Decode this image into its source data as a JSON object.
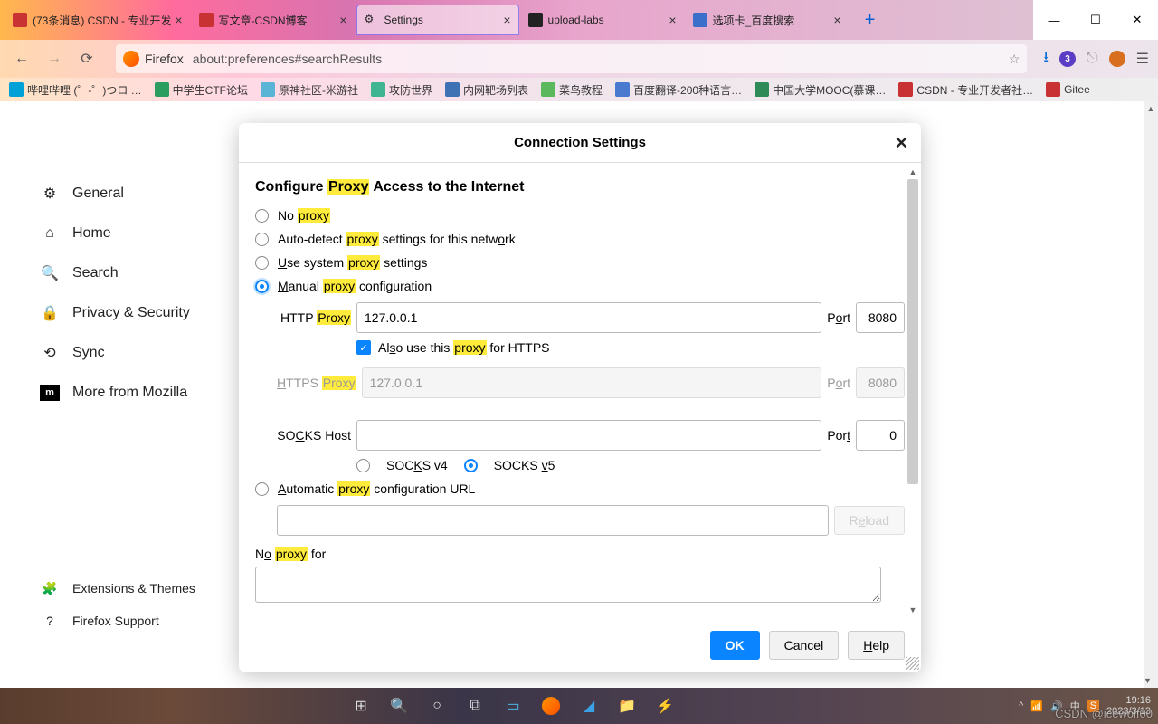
{
  "tabs": [
    {
      "label": "(73条消息) CSDN - 专业开发",
      "bg": "#c83232"
    },
    {
      "label": "写文章-CSDN博客",
      "bg": "#c83232"
    },
    {
      "label": "Settings",
      "bg": "#888",
      "active": true
    },
    {
      "label": "upload-labs",
      "bg": "#222"
    },
    {
      "label": "选项卡_百度搜索",
      "bg": "#3b6fc9"
    }
  ],
  "wincontrols": {
    "min": "—",
    "max": "☐",
    "close": "✕"
  },
  "nav": {
    "fx": "Firefox",
    "url": "about:preferences#searchResults",
    "badge": "3"
  },
  "bookmarks": [
    {
      "label": "哔哩哔哩 (゜-゜)つロ …",
      "bg": "#00a1d6"
    },
    {
      "label": "中学生CTF论坛",
      "bg": "#2a9d5f"
    },
    {
      "label": "原神社区-米游社",
      "bg": "#5ab4d6"
    },
    {
      "label": "攻防世界",
      "bg": "#3fb592"
    },
    {
      "label": "内网靶场列表",
      "bg": "#3f72b5"
    },
    {
      "label": "菜鸟教程",
      "bg": "#5cb85c"
    },
    {
      "label": "百度翻译-200种语言…",
      "bg": "#4a7ad0"
    },
    {
      "label": "中国大学MOOC(慕课…",
      "bg": "#2e8b57"
    },
    {
      "label": "CSDN - 专业开发者社…",
      "bg": "#c83232"
    },
    {
      "label": "Gitee",
      "bg": "#c83232"
    }
  ],
  "sidebar": [
    {
      "label": "General"
    },
    {
      "label": "Home"
    },
    {
      "label": "Search"
    },
    {
      "label": "Privacy & Security"
    },
    {
      "label": "Sync"
    },
    {
      "label": "More from Mozilla"
    }
  ],
  "sidebar_bottom": [
    {
      "label": "Extensions & Themes"
    },
    {
      "label": "Firefox Support"
    }
  ],
  "modal": {
    "title": "Connection Settings",
    "heading_pre": "Configure ",
    "heading_hl": "Proxy",
    "heading_post": " Access to the Internet",
    "r1_pre": "No ",
    "r1_hl": "proxy",
    "r2_pre": "Auto-detect ",
    "r2_hl": "proxy",
    "r2_post": " settings for this netw",
    "r2_u": "o",
    "r2_end": "rk",
    "r3_u": "U",
    "r3_pre": "se system ",
    "r3_hl": "proxy",
    "r3_post": " settings",
    "r4_u": "M",
    "r4_pre": "anual ",
    "r4_hl": "proxy",
    "r4_post": " configuration",
    "http_label_pre": "HTTP ",
    "http_label_hl": "Proxy",
    "http_value": "127.0.0.1",
    "http_port": "8080",
    "port_pre": "P",
    "port_u": "o",
    "port_post": "rt",
    "also_pre": "Al",
    "also_u": "s",
    "also_mid": "o use this ",
    "also_hl": "proxy",
    "also_post": " for HTTPS",
    "https_u": "H",
    "https_label_pre": "TTPS ",
    "https_label_hl": "Proxy",
    "https_value": "127.0.0.1",
    "https_port": "8080",
    "hport_pre": "P",
    "hport_u": "o",
    "hport_post": "rt",
    "socks_label": "SO",
    "socks_u": "C",
    "socks_label2": "KS Host",
    "socks_port": "0",
    "sport_pre": "Por",
    "sport_u": "t",
    "s4_pre": "SOC",
    "s4_u": "K",
    "s4_post": "S v4",
    "s5_pre": "SOCKS ",
    "s5_u": "v",
    "s5_post": "5",
    "r5_u": "A",
    "r5_pre": "utomatic ",
    "r5_hl": "proxy",
    "r5_post": " configuration URL",
    "reload_pre": "R",
    "reload_u": "e",
    "reload_post": "load",
    "np_u": "o",
    "np_pre": "N",
    "np_mid": " ",
    "np_hl": "proxy",
    "np_post": " for",
    "ok": "OK",
    "cancel": "Cancel",
    "help_u": "H",
    "help_post": "elp"
  },
  "tray": {
    "time": "19:16",
    "date": "2023/3/13"
  },
  "watermark": "CSDN @icewolf00"
}
